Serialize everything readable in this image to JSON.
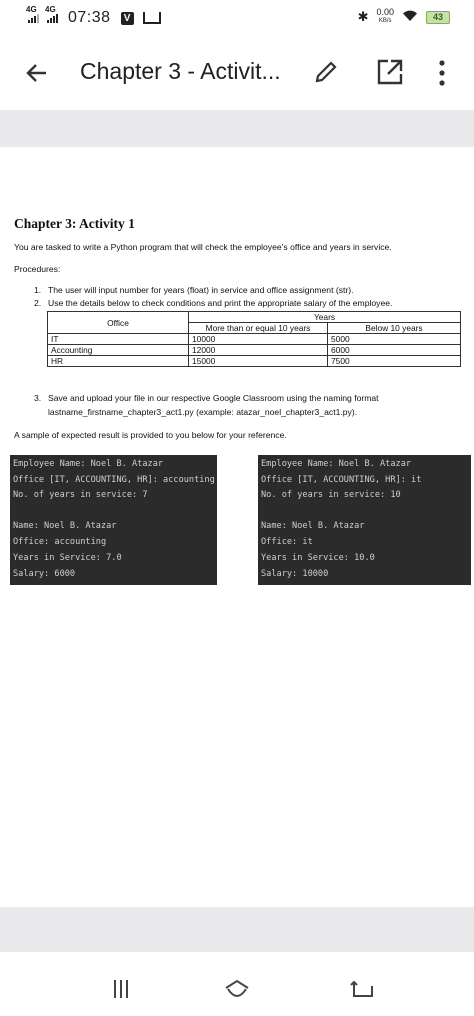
{
  "status_bar": {
    "network1": "4G",
    "network2": "4G",
    "time": "07:38",
    "app_badge": "V",
    "speed_value": "0.00",
    "speed_unit": "KB/s",
    "battery": "43"
  },
  "app_bar": {
    "title": "Chapter 3 - Activit...",
    "icons": [
      "back-arrow-icon",
      "edit-pencil-icon",
      "open-in-new-icon",
      "more-vert-icon"
    ]
  },
  "document": {
    "heading": "Chapter 3: Activity 1",
    "intro": "You are tasked to write a Python program that will check the employee’s office and years in service.",
    "procedures_label": "Procedures:",
    "steps": [
      {
        "num": "1.",
        "text": "The user will input number for years (float) in service and office assignment (str)."
      },
      {
        "num": "2.",
        "text": "Use the details below to check conditions and print the appropriate salary of the employee."
      }
    ],
    "table": {
      "office_header": "Office",
      "years_header": "Years",
      "col1": "More than or equal 10 years",
      "col2": "Below 10 years",
      "rows": [
        {
          "office": "IT",
          "ge10": "10000",
          "lt10": "5000"
        },
        {
          "office": "Accounting",
          "ge10": "12000",
          "lt10": "6000"
        },
        {
          "office": "HR",
          "ge10": "15000",
          "lt10": "7500"
        }
      ]
    },
    "step3": {
      "num": "3.",
      "line1": "Save and upload your file in our respective Google Classroom using the naming format",
      "line2": "lastname_firstname_chapter3_act1.py (example: atazar_noel_chapter3_act1.py)."
    },
    "sample_note": "A sample of expected result is provided to you below for your reference.",
    "terminals": [
      {
        "lines": [
          "Employee Name: Noel B. Atazar",
          "Office [IT, ACCOUNTING, HR]: accounting",
          "No. of years in service: 7",
          "Name: Noel B. Atazar",
          "Office: accounting",
          "Years in Service: 7.0",
          "Salary: 6000"
        ]
      },
      {
        "lines": [
          "Employee Name: Noel B. Atazar",
          "Office [IT, ACCOUNTING, HR]: it",
          "No. of years in service: 10",
          "Name: Noel B. Atazar",
          "Office: it",
          "Years in Service: 10.0",
          "Salary: 10000"
        ]
      }
    ]
  },
  "nav_bar": {
    "icons": [
      "recents-icon",
      "home-icon",
      "back-icon"
    ]
  }
}
